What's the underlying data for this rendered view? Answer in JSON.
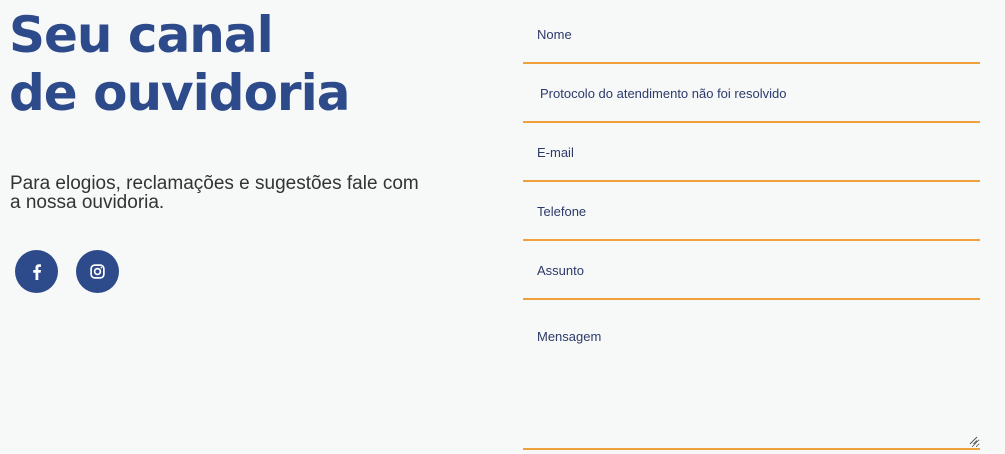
{
  "hero": {
    "title_line1": "Seu canal",
    "title_line2": "de ouvidoria",
    "subtitle": "Para elogios, reclamações e sugestões fale com a nossa ouvidoria."
  },
  "social": {
    "facebook_icon": "facebook-icon",
    "instagram_icon": "instagram-icon"
  },
  "form": {
    "nome_placeholder": "Nome",
    "protocolo_placeholder": "Protocolo do atendimento não foi resolvido",
    "email_placeholder": "E-mail",
    "telefone_placeholder": "Telefone",
    "assunto_placeholder": "Assunto",
    "mensagem_placeholder": "Mensagem"
  },
  "colors": {
    "brand_blue": "#2d4a8a",
    "accent_orange": "#f0a13b",
    "background": "#f7f8f8"
  }
}
